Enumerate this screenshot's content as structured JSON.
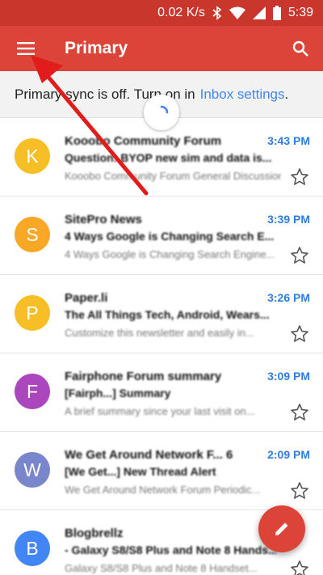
{
  "status_bar": {
    "network_speed": "0.02 K/s",
    "time": "5:39",
    "icons": [
      "bluetooth-icon",
      "wifi-icon",
      "signal-icon",
      "battery-icon"
    ]
  },
  "app_bar": {
    "title": "Primary",
    "menu_icon": "hamburger-menu-icon",
    "search_icon": "search-icon",
    "color": "#db4437"
  },
  "sync_banner": {
    "text": "Primary sync is off. Turn on in",
    "link": "Inbox settings",
    "trailing": "."
  },
  "messages": [
    {
      "initial": "K",
      "avatar_color": "#f6bf26",
      "sender": "Kooobo Community Forum",
      "subject": "Question: BYOP new sim and data is...",
      "snippet": "Kooobo Community Forum General Discussion...",
      "time": "3:43 PM"
    },
    {
      "initial": "S",
      "avatar_color": "#f9a825",
      "sender": "SitePro News",
      "subject": "4 Ways Google is Changing Search E...",
      "snippet": "4 Ways Google is Changing Search Engine...",
      "time": "3:39 PM"
    },
    {
      "initial": "P",
      "avatar_color": "#f6bf26",
      "sender": "Paper.li",
      "subject": "The All Things Tech, Android, Wears...",
      "snippet": "Customize this newsletter and easily in...",
      "time": "3:26 PM"
    },
    {
      "initial": "F",
      "avatar_color": "#ab47bc",
      "sender": "Fairphone Forum summary",
      "subject": "[Fairph...] Summary",
      "snippet": "A brief summary since your last visit on...",
      "time": "3:09 PM"
    },
    {
      "initial": "W",
      "avatar_color": "#7986cb",
      "sender": "We Get Around Network F...  6",
      "subject": "[We Get...] New Thread Alert",
      "snippet": "We Get Around Network Forum Periodic...",
      "time": "2:09 PM"
    },
    {
      "initial": "B",
      "avatar_color": "#4285f4",
      "sender": "Blogbrellz",
      "subject": "- Galaxy S8/S8 Plus and Note 8 Hands...",
      "snippet": "Galaxy S8/S8 Plus and Note 8 Handset...",
      "time": ""
    }
  ],
  "fab": {
    "icon": "pencil-icon",
    "color": "#db4437"
  },
  "annotation": {
    "icon": "red-arrow",
    "color": "#e21b1b"
  }
}
